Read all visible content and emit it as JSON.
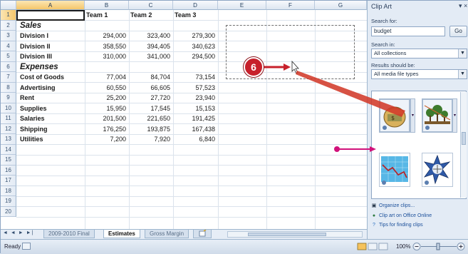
{
  "columns": [
    "A",
    "B",
    "C",
    "D",
    "E",
    "F",
    "G"
  ],
  "rows": [
    "1",
    "2",
    "3",
    "4",
    "5",
    "6",
    "7",
    "8",
    "9",
    "10",
    "11",
    "12",
    "13",
    "14",
    "15",
    "16",
    "17",
    "18",
    "19",
    "20"
  ],
  "headers": [
    "Team 1",
    "Team 2",
    "Team 3"
  ],
  "sections": {
    "sales": "Sales",
    "expenses": "Expenses"
  },
  "data_rows": [
    {
      "label": "Division I",
      "values": [
        "294,000",
        "323,400",
        "279,300"
      ]
    },
    {
      "label": "Division II",
      "values": [
        "358,550",
        "394,405",
        "340,623"
      ]
    },
    {
      "label": "Division III",
      "values": [
        "310,000",
        "341,000",
        "294,500"
      ]
    },
    {
      "label": "Cost of Goods",
      "values": [
        "77,004",
        "84,704",
        "73,154"
      ]
    },
    {
      "label": "Advertising",
      "values": [
        "60,550",
        "66,605",
        "57,523"
      ]
    },
    {
      "label": "Rent",
      "values": [
        "25,200",
        "27,720",
        "23,940"
      ]
    },
    {
      "label": "Supplies",
      "values": [
        "15,950",
        "17,545",
        "15,153"
      ]
    },
    {
      "label": "Salaries",
      "values": [
        "201,500",
        "221,650",
        "191,425"
      ]
    },
    {
      "label": "Shipping",
      "values": [
        "176,250",
        "193,875",
        "167,438"
      ]
    },
    {
      "label": "Utilities",
      "values": [
        "7,200",
        "7,920",
        "6,840"
      ]
    }
  ],
  "sheet_tabs": {
    "nav": "◄ ◄ ► ►|",
    "tabs": [
      "2009-2010 Final",
      "Estimates",
      "Gross Margin"
    ],
    "active": "Estimates"
  },
  "status": {
    "ready": "Ready",
    "zoom": "100%"
  },
  "clip_art": {
    "title": "Clip Art",
    "close": "▾ ×",
    "search_label": "Search for:",
    "search_value": "budget",
    "go": "Go",
    "search_in_label": "Search in:",
    "search_in_value": "All collections",
    "results_label": "Results should be:",
    "results_value": "All media file types",
    "links": [
      "Organize clips...",
      "Clip art on Office Online",
      "Tips for finding clips"
    ]
  },
  "callout": {
    "number": "6"
  }
}
